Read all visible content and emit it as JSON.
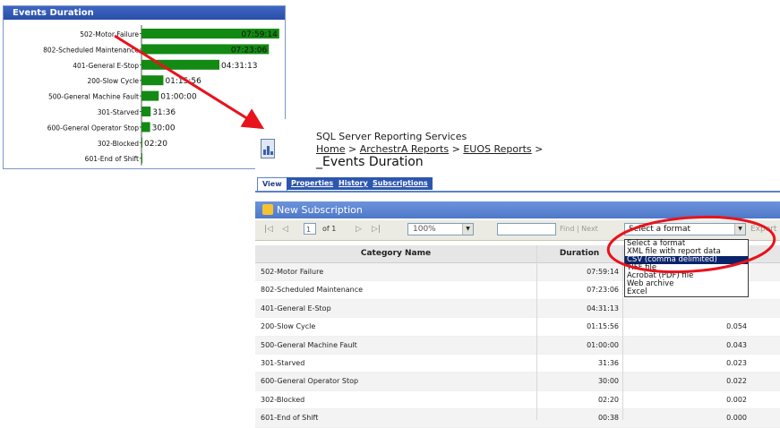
{
  "chart_panel": {
    "title": "Events Duration",
    "chart_data": {
      "type": "bar",
      "orientation": "horizontal",
      "title": "Events Duration",
      "categories": [
        "502-Motor Failure",
        "802-Scheduled Maintenance",
        "401-General E-Stop",
        "200-Slow Cycle",
        "500-General Machine Fault",
        "301-Starved",
        "600-General Operator Stop",
        "302-Blocked",
        "601-End of Shift"
      ],
      "values": [
        7.99,
        7.39,
        4.52,
        1.27,
        1.0,
        0.53,
        0.5,
        0.04,
        0.01
      ],
      "data_labels": [
        "07:59:14",
        "07:23:06",
        "04:31:13",
        "01:15:56",
        "01:00:00",
        "31:36",
        "30:00",
        "02:20",
        ""
      ],
      "bar_color": "#138a13",
      "xlim": [
        0,
        8
      ],
      "grid": false,
      "legend": "none"
    }
  },
  "report": {
    "service_title": "SQL Server Reporting Services",
    "breadcrumb": {
      "home": "Home",
      "sep": ">",
      "item1": "ArchestrA Reports",
      "item2": "EUOS Reports",
      "trail_end": ">"
    },
    "name": "_Events Duration",
    "tabs": [
      "View",
      "Properties",
      "History",
      "Subscriptions"
    ],
    "new_subscription": "New Subscription",
    "toolbar": {
      "first": "|◁",
      "prev": "◁",
      "page": "1",
      "of": "of 1",
      "next": "▷",
      "last": "▷|",
      "zoom": "100%",
      "find": "Find",
      "next_label": "Next",
      "format_selected": "Select a format",
      "export": "Export"
    },
    "format_options": [
      "Select a format",
      "XML file with report data",
      "CSV (comma delimited)",
      "TIFF file",
      "Acrobat (PDF) file",
      "Web archive",
      "Excel"
    ],
    "format_selected_index": 2,
    "columns": [
      "Category Name",
      "Duration"
    ],
    "rows": [
      {
        "name": "502-Motor Failure",
        "duration": "07:59:14",
        "ratio": ""
      },
      {
        "name": "802-Scheduled Maintenance",
        "duration": "07:23:06",
        "ratio": ""
      },
      {
        "name": "401-General E-Stop",
        "duration": "04:31:13",
        "ratio": ""
      },
      {
        "name": "200-Slow Cycle",
        "duration": "01:15:56",
        "ratio": "0.054"
      },
      {
        "name": "500-General Machine Fault",
        "duration": "01:00:00",
        "ratio": "0.043"
      },
      {
        "name": "301-Starved",
        "duration": "31:36",
        "ratio": "0.023"
      },
      {
        "name": "600-General Operator Stop",
        "duration": "30:00",
        "ratio": "0.022"
      },
      {
        "name": "302-Blocked",
        "duration": "02:20",
        "ratio": "0.002"
      },
      {
        "name": "601-End of Shift",
        "duration": "00:38",
        "ratio": "0.000"
      }
    ]
  },
  "annotation_color": "#e8131b"
}
